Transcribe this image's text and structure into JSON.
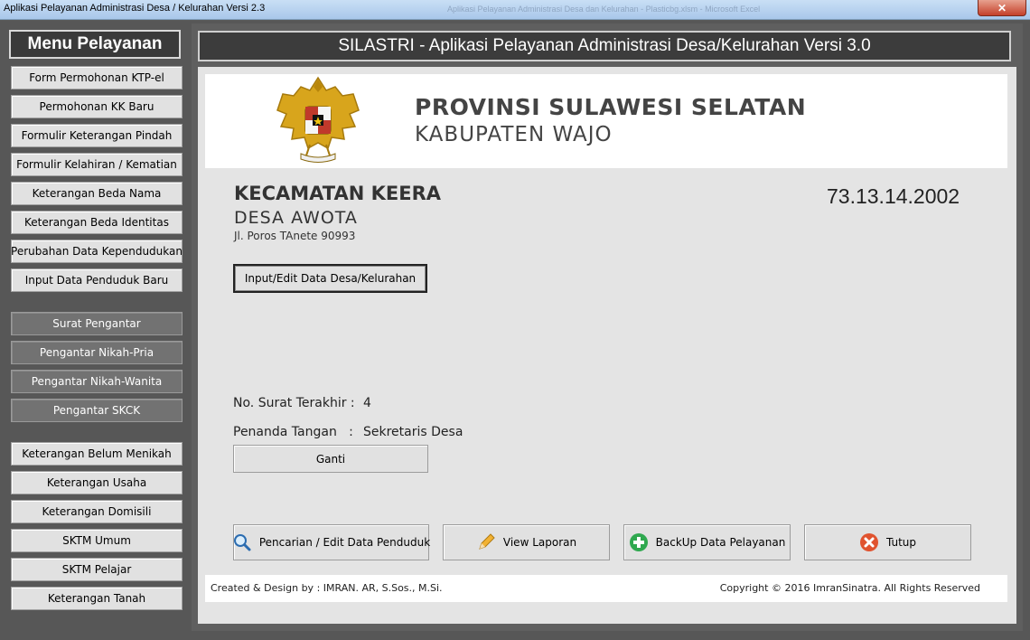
{
  "window": {
    "title": "Aplikasi Pelayanan Administrasi Desa / Kelurahan Versi 2.3",
    "background_title": "Aplikasi Pelayanan Administrasi Desa dan Kelurahan - Plasticbg.xlsm - Microsoft Excel",
    "close_label": "✕"
  },
  "sidebar": {
    "title": "Menu Pelayanan",
    "items": [
      {
        "label": "Form Permohonan KTP-el",
        "dark": false
      },
      {
        "label": "Permohonan KK Baru",
        "dark": false
      },
      {
        "label": "Formulir Keterangan Pindah",
        "dark": false
      },
      {
        "label": "Formulir Kelahiran / Kematian",
        "dark": false
      },
      {
        "label": "Keterangan Beda Nama",
        "dark": false
      },
      {
        "label": "Keterangan Beda Identitas",
        "dark": false
      },
      {
        "label": "Perubahan Data Kependudukan",
        "dark": false
      },
      {
        "label": "Input Data Penduduk Baru",
        "dark": false
      },
      {
        "label": "Surat Pengantar",
        "dark": true
      },
      {
        "label": "Pengantar Nikah-Pria",
        "dark": true
      },
      {
        "label": "Pengantar Nikah-Wanita",
        "dark": true
      },
      {
        "label": "Pengantar SKCK",
        "dark": true
      },
      {
        "label": "Keterangan Belum Menikah",
        "dark": false
      },
      {
        "label": "Keterangan Usaha",
        "dark": false
      },
      {
        "label": "Keterangan Domisili",
        "dark": false
      },
      {
        "label": "SKTM Umum",
        "dark": false
      },
      {
        "label": "SKTM Pelajar",
        "dark": false
      },
      {
        "label": "Keterangan Tanah",
        "dark": false
      }
    ]
  },
  "banner": "SILASTRI - Aplikasi Pelayanan Administrasi Desa/Kelurahan Versi 3.0",
  "header": {
    "provinsi": "PROVINSI SULAWESI SELATAN",
    "kabupaten": "KABUPATEN WAJO",
    "emblem_icon": "garuda-emblem-icon"
  },
  "desa": {
    "kecamatan": "KECAMATAN KEERA",
    "nama": "DESA AWOTA",
    "alamat": "Jl. Poros TAnete 90993",
    "kode": "73.13.14.2002"
  },
  "buttons": {
    "input_edit": "Input/Edit Data Desa/Kelurahan",
    "ganti": "Ganti",
    "pencarian": "Pencarian / Edit Data Penduduk",
    "view_laporan": "View Laporan",
    "backup": "BackUp Data Pelayanan",
    "tutup": "Tutup"
  },
  "info": {
    "no_surat_label": "No. Surat Terakhir :",
    "no_surat_value": "4",
    "penanda_label": "Penanda Tangan   :",
    "penanda_value": "Sekretaris Desa"
  },
  "footer": {
    "credit": "Created & Design by : IMRAN. AR, S.Sos., M.Si.",
    "copyright": "Copyright © 2016 ImranSinatra. All Rights Reserved"
  },
  "icons": {
    "search": "magnifier-icon",
    "view": "pencil-icon",
    "backup": "plus-circle-icon",
    "tutup": "close-circle-icon"
  },
  "colors": {
    "sidebar_dark_button": "#727272",
    "banner_bg": "#3c3c3c",
    "panel_bg": "#e4e4e4",
    "backup_icon": "#2fa84f",
    "tutup_icon": "#e0532f"
  }
}
